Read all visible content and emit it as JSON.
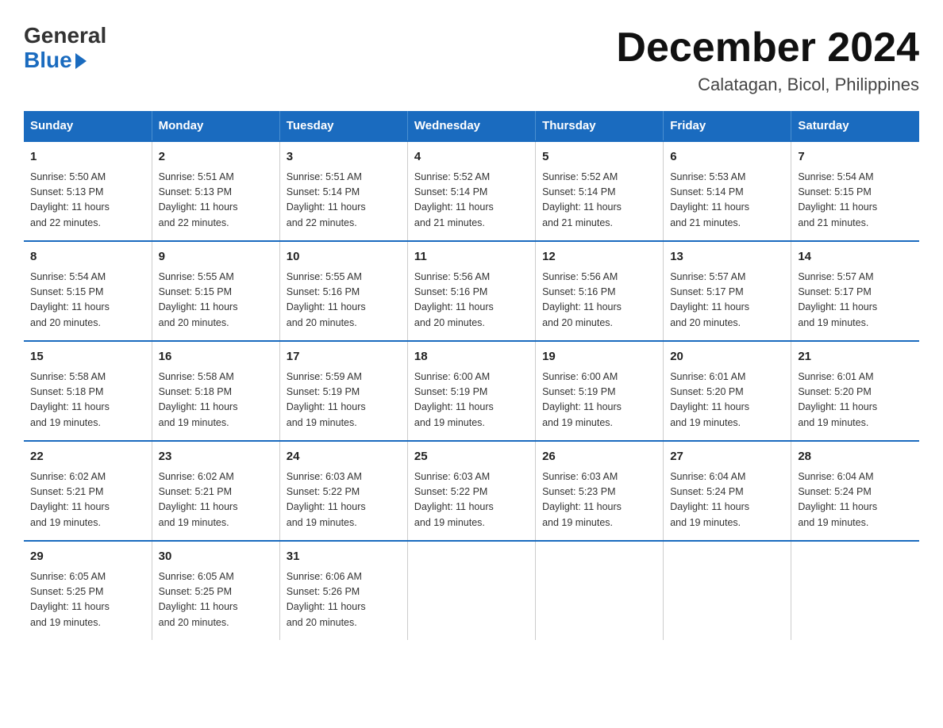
{
  "logo": {
    "general": "General",
    "blue": "Blue"
  },
  "header": {
    "month": "December 2024",
    "location": "Calatagan, Bicol, Philippines"
  },
  "days_of_week": [
    "Sunday",
    "Monday",
    "Tuesday",
    "Wednesday",
    "Thursday",
    "Friday",
    "Saturday"
  ],
  "weeks": [
    [
      {
        "day": "1",
        "sunrise": "5:50 AM",
        "sunset": "5:13 PM",
        "daylight": "11 hours and 22 minutes."
      },
      {
        "day": "2",
        "sunrise": "5:51 AM",
        "sunset": "5:13 PM",
        "daylight": "11 hours and 22 minutes."
      },
      {
        "day": "3",
        "sunrise": "5:51 AM",
        "sunset": "5:14 PM",
        "daylight": "11 hours and 22 minutes."
      },
      {
        "day": "4",
        "sunrise": "5:52 AM",
        "sunset": "5:14 PM",
        "daylight": "11 hours and 21 minutes."
      },
      {
        "day": "5",
        "sunrise": "5:52 AM",
        "sunset": "5:14 PM",
        "daylight": "11 hours and 21 minutes."
      },
      {
        "day": "6",
        "sunrise": "5:53 AM",
        "sunset": "5:14 PM",
        "daylight": "11 hours and 21 minutes."
      },
      {
        "day": "7",
        "sunrise": "5:54 AM",
        "sunset": "5:15 PM",
        "daylight": "11 hours and 21 minutes."
      }
    ],
    [
      {
        "day": "8",
        "sunrise": "5:54 AM",
        "sunset": "5:15 PM",
        "daylight": "11 hours and 20 minutes."
      },
      {
        "day": "9",
        "sunrise": "5:55 AM",
        "sunset": "5:15 PM",
        "daylight": "11 hours and 20 minutes."
      },
      {
        "day": "10",
        "sunrise": "5:55 AM",
        "sunset": "5:16 PM",
        "daylight": "11 hours and 20 minutes."
      },
      {
        "day": "11",
        "sunrise": "5:56 AM",
        "sunset": "5:16 PM",
        "daylight": "11 hours and 20 minutes."
      },
      {
        "day": "12",
        "sunrise": "5:56 AM",
        "sunset": "5:16 PM",
        "daylight": "11 hours and 20 minutes."
      },
      {
        "day": "13",
        "sunrise": "5:57 AM",
        "sunset": "5:17 PM",
        "daylight": "11 hours and 20 minutes."
      },
      {
        "day": "14",
        "sunrise": "5:57 AM",
        "sunset": "5:17 PM",
        "daylight": "11 hours and 19 minutes."
      }
    ],
    [
      {
        "day": "15",
        "sunrise": "5:58 AM",
        "sunset": "5:18 PM",
        "daylight": "11 hours and 19 minutes."
      },
      {
        "day": "16",
        "sunrise": "5:58 AM",
        "sunset": "5:18 PM",
        "daylight": "11 hours and 19 minutes."
      },
      {
        "day": "17",
        "sunrise": "5:59 AM",
        "sunset": "5:19 PM",
        "daylight": "11 hours and 19 minutes."
      },
      {
        "day": "18",
        "sunrise": "6:00 AM",
        "sunset": "5:19 PM",
        "daylight": "11 hours and 19 minutes."
      },
      {
        "day": "19",
        "sunrise": "6:00 AM",
        "sunset": "5:19 PM",
        "daylight": "11 hours and 19 minutes."
      },
      {
        "day": "20",
        "sunrise": "6:01 AM",
        "sunset": "5:20 PM",
        "daylight": "11 hours and 19 minutes."
      },
      {
        "day": "21",
        "sunrise": "6:01 AM",
        "sunset": "5:20 PM",
        "daylight": "11 hours and 19 minutes."
      }
    ],
    [
      {
        "day": "22",
        "sunrise": "6:02 AM",
        "sunset": "5:21 PM",
        "daylight": "11 hours and 19 minutes."
      },
      {
        "day": "23",
        "sunrise": "6:02 AM",
        "sunset": "5:21 PM",
        "daylight": "11 hours and 19 minutes."
      },
      {
        "day": "24",
        "sunrise": "6:03 AM",
        "sunset": "5:22 PM",
        "daylight": "11 hours and 19 minutes."
      },
      {
        "day": "25",
        "sunrise": "6:03 AM",
        "sunset": "5:22 PM",
        "daylight": "11 hours and 19 minutes."
      },
      {
        "day": "26",
        "sunrise": "6:03 AM",
        "sunset": "5:23 PM",
        "daylight": "11 hours and 19 minutes."
      },
      {
        "day": "27",
        "sunrise": "6:04 AM",
        "sunset": "5:24 PM",
        "daylight": "11 hours and 19 minutes."
      },
      {
        "day": "28",
        "sunrise": "6:04 AM",
        "sunset": "5:24 PM",
        "daylight": "11 hours and 19 minutes."
      }
    ],
    [
      {
        "day": "29",
        "sunrise": "6:05 AM",
        "sunset": "5:25 PM",
        "daylight": "11 hours and 19 minutes."
      },
      {
        "day": "30",
        "sunrise": "6:05 AM",
        "sunset": "5:25 PM",
        "daylight": "11 hours and 20 minutes."
      },
      {
        "day": "31",
        "sunrise": "6:06 AM",
        "sunset": "5:26 PM",
        "daylight": "11 hours and 20 minutes."
      },
      null,
      null,
      null,
      null
    ]
  ],
  "labels": {
    "sunrise": "Sunrise:",
    "sunset": "Sunset:",
    "daylight": "Daylight:"
  }
}
